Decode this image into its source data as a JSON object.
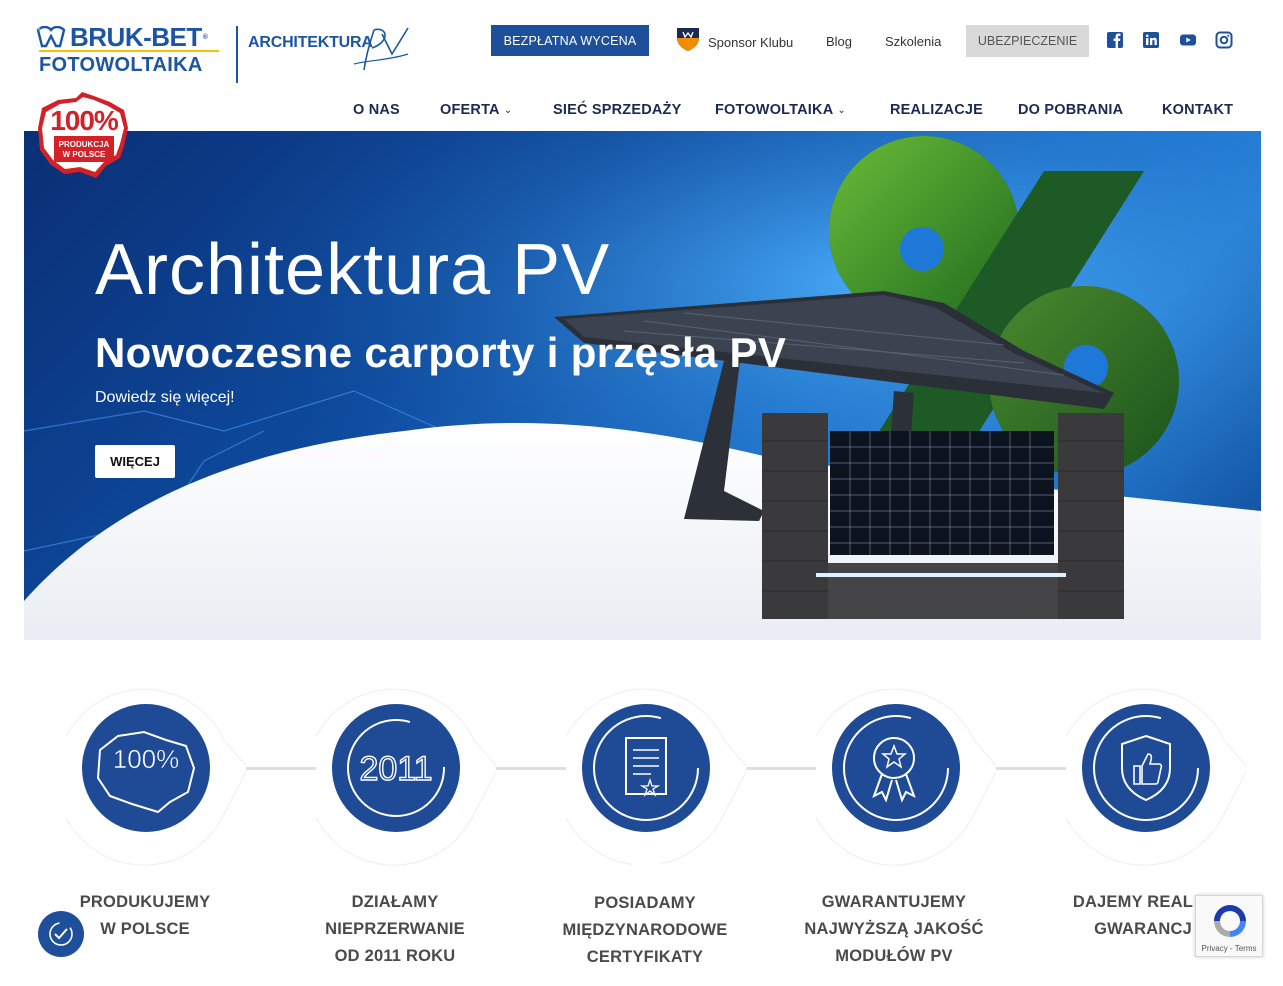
{
  "header": {
    "logo_brand_line1": "BRUK-BET",
    "logo_brand_reg": "®",
    "logo_brand_line2": "FOTOWOLTAIKA",
    "logo_arch_text": "ARCHITEKTURA",
    "btn_wycena": "BEZPŁATNA WYCENA",
    "sponsor": "Sponsor Klubu",
    "blog": "Blog",
    "szkolenia": "Szkolenia",
    "btn_ubezp": "UBEZPIECZENIE",
    "social": [
      "facebook-icon",
      "linkedin-icon",
      "youtube-icon",
      "instagram-icon"
    ]
  },
  "nav": {
    "items": [
      {
        "label": "O NAS",
        "dropdown": false
      },
      {
        "label": "OFERTA",
        "dropdown": true
      },
      {
        "label": "SIEĆ SPRZEDAŻY",
        "dropdown": false
      },
      {
        "label": "FOTOWOLTAIKA",
        "dropdown": true
      },
      {
        "label": "REALIZACJE",
        "dropdown": false
      },
      {
        "label": "DO POBRANIA",
        "dropdown": false
      },
      {
        "label": "KONTAKT",
        "dropdown": false
      }
    ]
  },
  "badge": {
    "percent": "100%",
    "line1": "PRODUKCJA",
    "line2": "W POLSCE"
  },
  "hero": {
    "title": "Architektura PV",
    "subtitle": "Nowoczesne carporty i przęsła PV",
    "link": "Dowiedz się więcej!",
    "button": "WIĘCEJ"
  },
  "features": [
    {
      "icon": "poland-100-icon",
      "icon_text": "100%",
      "line1": "PRODUKUJEMY",
      "line2": "W POLSCE",
      "line3": ""
    },
    {
      "icon": "year-2011-icon",
      "icon_text": "2011",
      "line1": "DZIAŁAMY",
      "line2": "NIEPRZERWANIE",
      "line3": "OD 2011 ROKU"
    },
    {
      "icon": "certificate-icon",
      "icon_text": "",
      "line1": "POSIADAMY",
      "line2": "MIĘDZYNARODOWE",
      "line3": "CERTYFIKATY"
    },
    {
      "icon": "award-icon",
      "icon_text": "",
      "line1": "GWARANTUJEMY",
      "line2": "NAJWYŻSZĄ JAKOŚĆ",
      "line3": "MODUŁÓW PV"
    },
    {
      "icon": "shield-thumb-icon",
      "icon_text": "",
      "line1": "DAJEMY REAL",
      "line2": "GWARANCJ",
      "line3": ""
    }
  ],
  "recaptcha": {
    "links": "Privacy - Terms"
  },
  "colors": {
    "brand_blue": "#1d55a5",
    "button_blue": "#1d4f9a",
    "circle_blue": "#1e4a96",
    "badge_red": "#d42027"
  }
}
